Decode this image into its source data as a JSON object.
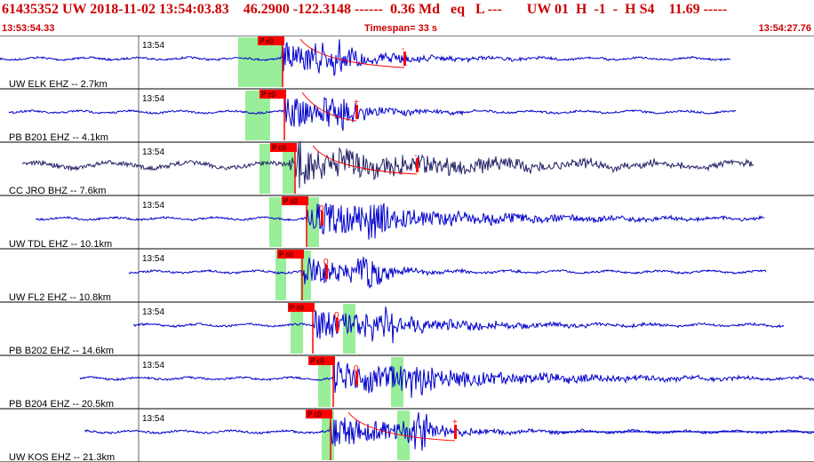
{
  "header": {
    "title": "61435352 UW 2018-11-02 13:54:03.83    46.2900 -122.3148 ------  0.36 Md   eq   L ---       UW 01  H  -1  -  H S4    11.69 -----",
    "start_time": "13:53:54.33",
    "timespan": "Timespan=  33 s",
    "end_time": "13:54:27.76"
  },
  "colors": {
    "trace": "#0000cc",
    "trace_dark": "#222266",
    "pick": "#ff0000",
    "window": "#99ee99",
    "title": "#cc0000"
  },
  "traces": [
    {
      "label": "UW ELK EHZ -- 2.7km",
      "time": "13:54",
      "pick": "P c0",
      "mark": "-",
      "dark": false
    },
    {
      "label": "PB B201 EHZ -- 4.1km",
      "time": "13:54",
      "pick": "P c0",
      "mark": "+",
      "dark": false
    },
    {
      "label": "CC JRO BHZ -- 7.6km",
      "time": "13:54",
      "pick": "P c0",
      "mark": "-",
      "dark": true
    },
    {
      "label": "UW TDL EHZ -- 10.1km",
      "time": "13:54",
      "pick": "P c0",
      "mark": "0",
      "dark": false
    },
    {
      "label": "UW FL2 EHZ -- 10.8km",
      "time": "13:54",
      "pick": "P c0",
      "mark": "0",
      "dark": false
    },
    {
      "label": "PB B202 EHZ -- 14.6km",
      "time": "13:54",
      "pick": "P c0",
      "mark": "0",
      "dark": false
    },
    {
      "label": "PB B204 EHZ -- 20.5km",
      "time": "13:54",
      "pick": "P c0",
      "mark": "0",
      "dark": false
    },
    {
      "label": "UW KOS EHZ -- 21.3km",
      "time": "13:54",
      "pick": "P c0",
      "mark": "+",
      "dark": false
    }
  ]
}
